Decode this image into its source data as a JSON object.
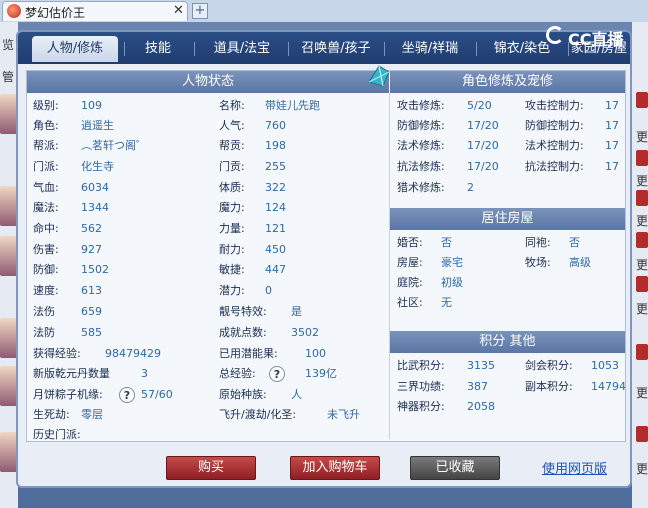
{
  "browser": {
    "tab_title": "梦幻估价王",
    "close": "✕",
    "new_tab": "+"
  },
  "overlay": {
    "logo_text": "CC直播"
  },
  "dialog": {
    "tabs": [
      "人物/修炼",
      "技能",
      "道具/法宝",
      "召唤兽/孩子",
      "坐骑/祥瑞",
      "锦衣/染色",
      "家园/房屋"
    ],
    "active_tab": 0,
    "headers": {
      "status": "人物状态",
      "cultivation": "角色修炼及宠修",
      "residence": "居住房屋",
      "points": "积分 其他"
    },
    "status_left": [
      {
        "label": "级别:",
        "value": "109"
      },
      {
        "label": "角色:",
        "value": "逍遥生"
      },
      {
        "label": "帮派:",
        "value": "︵茗轩つ阁゜"
      },
      {
        "label": "门派:",
        "value": "化生寺"
      },
      {
        "label": "气血:",
        "value": "6034"
      },
      {
        "label": "魔法:",
        "value": "1344"
      },
      {
        "label": "命中:",
        "value": "562"
      },
      {
        "label": "伤害:",
        "value": "927"
      },
      {
        "label": "防御:",
        "value": "1502"
      },
      {
        "label": "速度:",
        "value": "613"
      },
      {
        "label": "法伤",
        "value": "659"
      },
      {
        "label": "法防",
        "value": "585"
      },
      {
        "label": "获得经验:",
        "value": "98479429"
      },
      {
        "label": "新版乾元丹数量",
        "value": "3"
      },
      {
        "label": "月饼粽子机缘:",
        "value": "57/60"
      },
      {
        "label": "生死劫:",
        "value": "零层"
      },
      {
        "label": "历史门派:",
        "value": ""
      }
    ],
    "status_right": [
      {
        "label": "名称:",
        "value": "带娃儿先跑"
      },
      {
        "label": "人气:",
        "value": "760"
      },
      {
        "label": "帮贡:",
        "value": "198"
      },
      {
        "label": "门贡:",
        "value": "255"
      },
      {
        "label": "体质:",
        "value": "322"
      },
      {
        "label": "魔力:",
        "value": "124"
      },
      {
        "label": "力量:",
        "value": "121"
      },
      {
        "label": "耐力:",
        "value": "450"
      },
      {
        "label": "敏捷:",
        "value": "447"
      },
      {
        "label": "潜力:",
        "value": "0"
      },
      {
        "label": "靓号特效:",
        "value": "是"
      },
      {
        "label": "成就点数:",
        "value": "3502"
      },
      {
        "label": "已用潜能果:",
        "value": "100"
      },
      {
        "label": "总经验:",
        "value": "139亿"
      },
      {
        "label": "原始种族:",
        "value": "人"
      },
      {
        "label": "飞升/渡劫/化圣:",
        "value": "未飞升"
      }
    ],
    "cultivation": [
      {
        "label": "攻击修炼:",
        "value": "5/20",
        "label2": "攻击控制力:",
        "value2": "17"
      },
      {
        "label": "防御修炼:",
        "value": "17/20",
        "label2": "防御控制力:",
        "value2": "17"
      },
      {
        "label": "法术修炼:",
        "value": "17/20",
        "label2": "法术控制力:",
        "value2": "17"
      },
      {
        "label": "抗法修炼:",
        "value": "17/20",
        "label2": "抗法控制力:",
        "value2": "17"
      },
      {
        "label": "猎术修炼:",
        "value": "2"
      }
    ],
    "residence": [
      {
        "label": "婚否:",
        "value": "否",
        "label2": "同袍:",
        "value2": "否"
      },
      {
        "label": "房屋:",
        "value": "豪宅",
        "label2": "牧场:",
        "value2": "高级"
      },
      {
        "label": "庭院:",
        "value": "初级"
      },
      {
        "label": "社区:",
        "value": "无"
      }
    ],
    "points": [
      {
        "label": "比武积分:",
        "value": "3135",
        "label2": "剑会积分:",
        "value2": "1053"
      },
      {
        "label": "三界功绩:",
        "value": "387",
        "label2": "副本积分:",
        "value2": "14794"
      },
      {
        "label": "神器积分:",
        "value": "2058"
      }
    ],
    "help_mark": "?",
    "buttons": {
      "buy": "购买",
      "add_cart": "加入购物车",
      "collected": "已收藏"
    },
    "web_link": "使用网页版"
  },
  "background": {
    "left_chars": [
      "览",
      "管"
    ],
    "right_chars": [
      "更",
      "更",
      "更",
      "更",
      "更",
      "更",
      "更"
    ]
  }
}
